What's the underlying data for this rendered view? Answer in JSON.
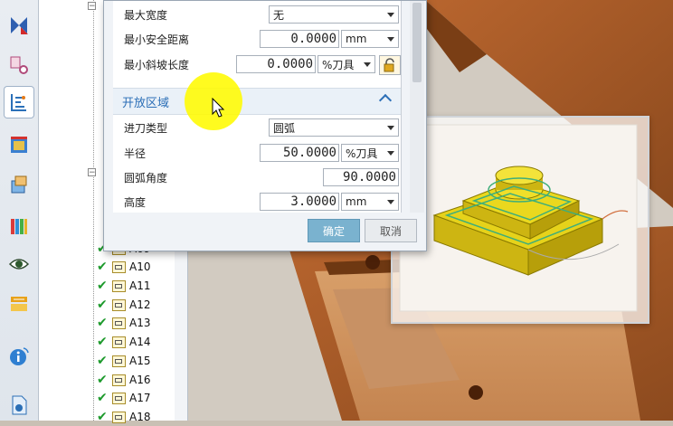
{
  "tree": {
    "items": [
      "A10",
      "A11",
      "A12",
      "A13",
      "A14",
      "A15",
      "A16",
      "A17",
      "A18"
    ],
    "partial_item": "A09"
  },
  "dialog": {
    "rows": {
      "max_width": {
        "label": "最大宽度",
        "value": "无"
      },
      "min_safe_distance": {
        "label": "最小安全距离",
        "value": "0.0000",
        "unit": "mm"
      },
      "min_ramp_length": {
        "label": "最小斜坡长度",
        "value": "0.0000",
        "unit": "%刀具"
      }
    },
    "section_open_area": {
      "title": "开放区域"
    },
    "open_area": {
      "entry_type": {
        "label": "进刀类型",
        "value": "圆弧"
      },
      "radius": {
        "label": "半径",
        "value": "50.0000",
        "unit": "%刀具"
      },
      "arc_angle": {
        "label": "圆弧角度",
        "value": "90.0000"
      },
      "height": {
        "label": "高度",
        "value": "3.0000",
        "unit": "mm"
      }
    },
    "buttons": {
      "ok": "确定",
      "cancel": "取消"
    }
  },
  "colors": {
    "part_yellow": "#e6d21a",
    "mold_brown": "#a55a2a",
    "section_blue": "#2c6fb7",
    "ok_button": "#7ab2cf",
    "highlight": "#fff700"
  },
  "icons": [
    "mesh-icon",
    "geometry-icon",
    "operation-navigator-icon",
    "machine-tool-icon",
    "method-icon",
    "library-icon",
    "view-icon",
    "feature-icon",
    "info-icon",
    "document-icon",
    "lock-icon",
    "cursor-icon"
  ]
}
